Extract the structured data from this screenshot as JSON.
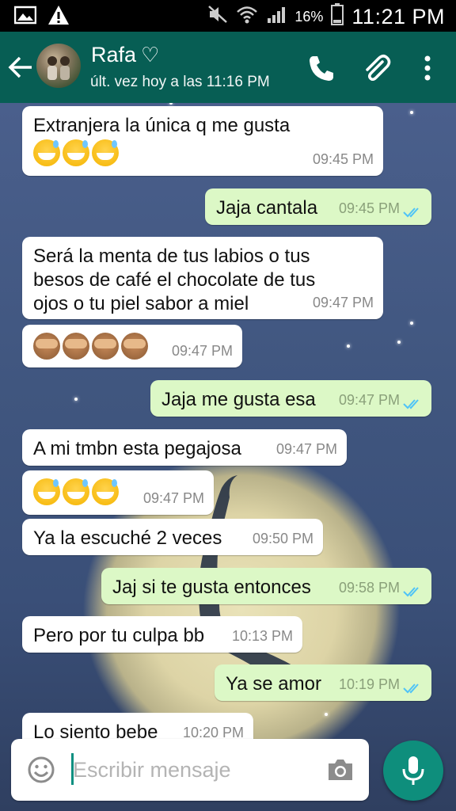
{
  "status_bar": {
    "battery_percent": "16%",
    "time": "11:21 PM",
    "icons": [
      "image-icon",
      "warning-icon",
      "mute-icon",
      "wifi-icon",
      "signal-icon",
      "battery-icon"
    ]
  },
  "header": {
    "contact_name": "Rafa",
    "name_suffix": "♡",
    "last_seen": "últ. vez hoy a las 11:16 PM",
    "icons": [
      "back-arrow-icon",
      "phone-icon",
      "paperclip-icon",
      "more-vert-icon"
    ]
  },
  "messages": [
    {
      "direction": "in",
      "text": "Extranjera la única q me gusta",
      "emoji": "sweat-smile x3",
      "time": "09:45 PM"
    },
    {
      "direction": "out",
      "text": "Jaja cantala",
      "time": "09:45 PM",
      "read": true
    },
    {
      "direction": "in",
      "lines": [
        "Será la menta de tus labios o tus",
        "besos de café el chocolate de tus",
        "ojos o tu piel sabor a miel"
      ],
      "time": "09:47 PM"
    },
    {
      "direction": "in",
      "emoji": "see-no-evil-monkey x4",
      "time": "09:47 PM"
    },
    {
      "direction": "out",
      "text": "Jaja me gusta esa",
      "time": "09:47 PM",
      "read": true
    },
    {
      "direction": "in",
      "text": "A mi tmbn esta pegajosa",
      "time": "09:47 PM"
    },
    {
      "direction": "in",
      "emoji": "sweat-smile x3",
      "time": "09:47 PM"
    },
    {
      "direction": "in",
      "text": "Ya la escuché 2 veces",
      "time": "09:50 PM"
    },
    {
      "direction": "out",
      "text": "Jaj si te gusta entonces",
      "time": "09:58 PM",
      "read": true
    },
    {
      "direction": "in",
      "text": "Pero por tu culpa bb",
      "time": "10:13 PM"
    },
    {
      "direction": "out",
      "text": "Ya se amor",
      "time": "10:19 PM",
      "read": true
    },
    {
      "direction": "in",
      "text": "Lo siento bebe",
      "time": "10:20 PM",
      "partially_hidden": true
    }
  ],
  "composer": {
    "placeholder": "Escribir mensaje",
    "value": ""
  },
  "colors": {
    "app_bar": "#075e54",
    "outgoing_bubble": "#dcf8c6",
    "incoming_bubble": "#ffffff",
    "mic_button": "#0e8e7c",
    "read_ticks": "#4fc3f7"
  }
}
